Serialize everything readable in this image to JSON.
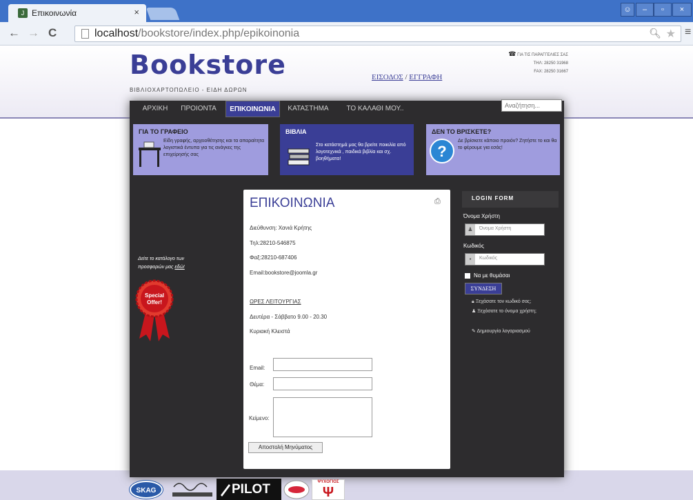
{
  "browser": {
    "tab_title": "Επικοινωνία",
    "url_host": "localhost",
    "url_path": "/bookstore/index.php/epikoinonia"
  },
  "site": {
    "logo": "Bookstore",
    "tagline": "ΒΙΒΛΙΟΧΑΡΤΟΠΩΛΕΙΟ - ΕΙΔΗ ΔΩΡΩΝ",
    "login_link": "ΕΙΣΟΔΟΣ",
    "separator": "/",
    "register_link": "ΕΓΓΡΑΦΗ",
    "contact_info_title": "ΓΙΑ ΤΙΣ ΠΑΡΑΓΓΕΛΙΕΣ ΣΑΣ",
    "contact_tel": "ΤΗΛ: 28250 31968",
    "contact_fax": "FAX: 28250 31667"
  },
  "nav": {
    "items": [
      {
        "label": "ΑΡΧΙΚΗ"
      },
      {
        "label": "ΠΡΟΙΟΝΤΑ"
      },
      {
        "label": "ΕΠΙΚΟΙΝΩΝΙΑ",
        "active": true
      },
      {
        "label": "ΚΑΤΑΣΤΗΜΑ"
      },
      {
        "label": "ΤΟ ΚΑΛΑΘΙ ΜΟΥ.."
      }
    ],
    "search_placeholder": "Αναζήτηση..."
  },
  "features": [
    {
      "heading": "ΓΙΑ ΤΟ ΓΡΑΦΕΙΟ",
      "text": "Είδη γραφής, αρχειοθέτησης και τα απαραίτητα λογιστικά έντυπα για τις ανάγκες της επιχείρησής σας"
    },
    {
      "heading": "ΒΙΒΛΙΑ",
      "text": "Στο κατάστημά μας θα βρείτε ποικιλία από λογοτεχνικά , παιδικά βιβλία και σχ. βοηθήματα!"
    },
    {
      "heading": "ΔΕΝ ΤΟ ΒΡΙΣΚΕΤΕ?",
      "text": "Δε βρίσκετε κάποιο προιόν? Ζητήστε το και θα το φέρουμε για εσάς!"
    }
  ],
  "sidebar": {
    "catalog_text": "Δείτε το κατάλογο των προσφορών μας",
    "catalog_link": "εδώ!",
    "offer_line1": "Special",
    "offer_line2": "Offer!"
  },
  "contact": {
    "title": "ΕΠΙΚΟΙΝΩΝΙΑ",
    "address": "Διεύθυνση: Χανιά Κρήτης",
    "phone": "Τηλ:28210-546875",
    "fax": "Φαξ:28210-687406",
    "email": "Email:bookstore@joomla.gr",
    "hours_title": "ΩΡΕΣ ΛΕΙΤΟΥΡΓΙΑΣ",
    "hours_weekdays": "Δευτέρα - Σάββατο 9.00 - 20.30",
    "hours_sunday": "Κυριακή Κλειστά",
    "form": {
      "email_label": "Email:",
      "subject_label": "Θέμα:",
      "message_label": "Κείμενο:",
      "submit": "Αποστολή Μηνύματος"
    }
  },
  "login": {
    "heading": "LOGIN FORM",
    "username_label": "Όνομα Χρήστη",
    "username_placeholder": "Όνομα Χρήστη",
    "password_label": "Κωδικός",
    "password_placeholder": "Κωδικός",
    "remember": "Να με θυμάσαι",
    "submit": "ΣΥΝΔΕΣΗ",
    "forgot_password": "Ξεχάσατε τον κωδικό σας;",
    "forgot_username": "Ξεχάσατε το όνομα χρήστη;",
    "create_account": "Δημιουργία λογαριασμού"
  },
  "sponsors": {
    "skag": "SKAG",
    "pilot": "PILOT",
    "psychos": "ΨΥΧΟΓΙΟΣ"
  }
}
